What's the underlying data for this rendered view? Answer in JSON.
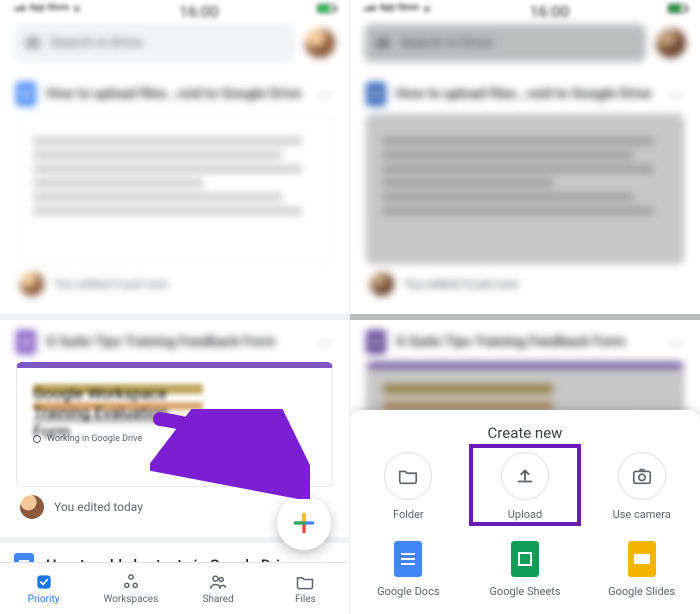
{
  "status": {
    "carrier_text": "App Store",
    "time": "16:00"
  },
  "search": {
    "placeholder": "Search in Drive"
  },
  "files": {
    "doc1_title": "How to upload files...roid to Google Drive",
    "doc1_editor": "You edited it just now",
    "form_title": "G Suite Tips Training Feedback Form",
    "form_preview_heading": "Google Workspace Training Evaluation Form",
    "form_radio_label": "Working in Google Drive",
    "form_editor": "You edited today",
    "doc2_title": "How to add shortcuts in Google Drive"
  },
  "tabs": {
    "priority": "Priority",
    "workspaces": "Workspaces",
    "shared": "Shared",
    "files": "Files"
  },
  "sheet": {
    "title": "Create new",
    "folder": "Folder",
    "upload": "Upload",
    "camera": "Use camera",
    "docs": "Google Docs",
    "sheets": "Google Sheets",
    "slides": "Google Slides"
  }
}
